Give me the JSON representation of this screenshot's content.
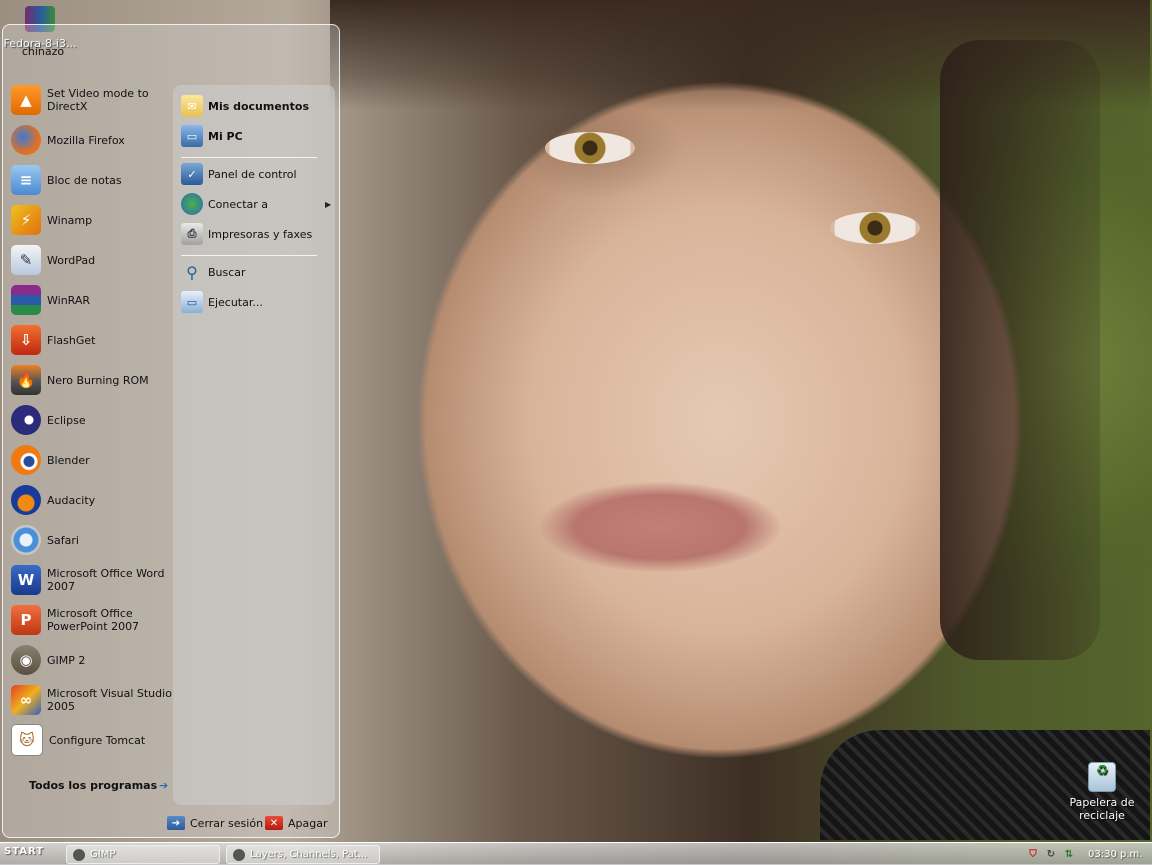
{
  "desktop": {
    "top_left_icon": {
      "label": "Fedora-8-i3..."
    },
    "recycle_bin": {
      "label": "Papelera de reciclaje"
    }
  },
  "start_menu": {
    "user_name": "chinazo",
    "programs": [
      {
        "label": "Set Video mode to DirectX",
        "icon": "vlc-cone-icon"
      },
      {
        "label": "Mozilla Firefox",
        "icon": "firefox-icon"
      },
      {
        "label": "Bloc de notas",
        "icon": "notepad-icon"
      },
      {
        "label": "Winamp",
        "icon": "winamp-icon"
      },
      {
        "label": "WordPad",
        "icon": "wordpad-icon"
      },
      {
        "label": "WinRAR",
        "icon": "winrar-icon"
      },
      {
        "label": "FlashGet",
        "icon": "flashget-icon"
      },
      {
        "label": "Nero Burning ROM",
        "icon": "nero-icon"
      },
      {
        "label": "Eclipse",
        "icon": "eclipse-icon"
      },
      {
        "label": "Blender",
        "icon": "blender-icon"
      },
      {
        "label": "Audacity",
        "icon": "audacity-icon"
      },
      {
        "label": "Safari",
        "icon": "safari-icon"
      },
      {
        "label": "Microsoft Office Word 2007",
        "icon": "word-icon"
      },
      {
        "label": "Microsoft Office PowerPoint 2007",
        "icon": "powerpoint-icon"
      },
      {
        "label": "GIMP 2",
        "icon": "gimp-icon"
      },
      {
        "label": "Microsoft Visual Studio 2005",
        "icon": "visual-studio-icon"
      },
      {
        "label": "Configure Tomcat",
        "icon": "tomcat-icon"
      }
    ],
    "all_programs": "Todos los programas",
    "places": [
      {
        "label": "Mis documentos",
        "bold": true,
        "icon": "documents-folder-icon"
      },
      {
        "label": "Mi PC",
        "bold": true,
        "icon": "my-computer-icon"
      },
      {
        "label": "Panel de control",
        "bold": false,
        "icon": "control-panel-icon"
      },
      {
        "label": "Conectar a",
        "bold": false,
        "icon": "network-globe-icon"
      },
      {
        "label": "Impresoras y faxes",
        "bold": false,
        "icon": "printer-icon"
      },
      {
        "label": "Buscar",
        "bold": false,
        "icon": "search-icon"
      },
      {
        "label": "Ejecutar...",
        "bold": false,
        "icon": "run-icon"
      }
    ],
    "logoff": "Cerrar sesión",
    "shutdown": "Apagar"
  },
  "taskbar": {
    "start": "START",
    "tasks": [
      {
        "label": "GIMP"
      },
      {
        "label": "Layers, Channels, Pat..."
      }
    ],
    "clock": "03:30 p.m."
  }
}
